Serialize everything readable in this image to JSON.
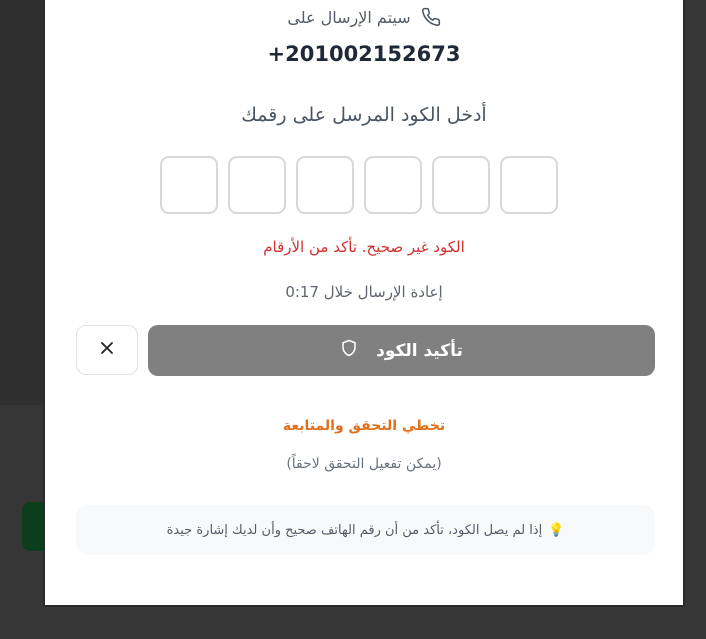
{
  "verification": {
    "send_label": "سيتم الإرسال على",
    "phone_number": "+201002152673",
    "prompt": "أدخل الكود المرسل على رقمك",
    "otp_digits": [
      "",
      "",
      "",
      "",
      "",
      ""
    ],
    "error_message": "الكود غير صحيح. تأكد من الأرقام",
    "resend_text": "إعادة الإرسال خلال 0:17",
    "confirm_label": "تأكيد الكود",
    "skip_label": "تخطي التحقق والمتابعة",
    "skip_note": "(يمكن تفعيل التحقق لاحقاً)",
    "tip_icon": "💡",
    "tip_text": "إذا لم يصل الكود، تأكد من أن رقم الهاتف صحيح وأن لديك إشارة جيدة"
  },
  "icons": {
    "phone": "phone-icon",
    "shield": "shield-icon",
    "close": "close-icon",
    "bulb": "lightbulb-icon"
  },
  "colors": {
    "error": "#d32f2f",
    "skip_link": "#e0701c",
    "confirm_button_disabled": "#808080",
    "backdrop": "#363636"
  }
}
